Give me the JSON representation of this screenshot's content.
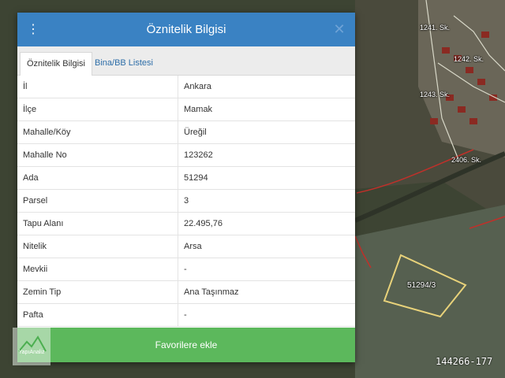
{
  "dialog": {
    "title": "Öznitelik Bilgisi",
    "menu_icon": "vertical-dots-icon",
    "close_icon": "close-icon",
    "tabs": [
      {
        "label": "Öznitelik Bilgisi",
        "active": true
      },
      {
        "label": "Bina/BB Listesi",
        "active": false
      }
    ],
    "rows": [
      {
        "key": "İl",
        "value": "Ankara"
      },
      {
        "key": "İlçe",
        "value": "Mamak"
      },
      {
        "key": "Mahalle/Köy",
        "value": "Üreğil"
      },
      {
        "key": "Mahalle No",
        "value": "123262"
      },
      {
        "key": "Ada",
        "value": "51294"
      },
      {
        "key": "Parsel",
        "value": "3"
      },
      {
        "key": "Tapu Alanı",
        "value": "22.495,76"
      },
      {
        "key": "Nitelik",
        "value": "Arsa"
      },
      {
        "key": "Mevkii",
        "value": "-"
      },
      {
        "key": "Zemin Tip",
        "value": "Ana Taşınmaz"
      },
      {
        "key": "Pafta",
        "value": "-"
      }
    ],
    "favorite_button": "Favorilere ekle"
  },
  "map": {
    "parcel_label": "51294/3",
    "street_labels": [
      "1241. Sk.",
      "1242. Sk.",
      "1243. Sk.",
      "2406. Sk."
    ]
  },
  "logo": {
    "text": "YapıAnaliz"
  },
  "listing_id": "144266-177",
  "colors": {
    "header": "#3a82c3",
    "button": "#5cb85c",
    "parcel_outline": "#e8d27a",
    "boundary": "#c0302a"
  }
}
